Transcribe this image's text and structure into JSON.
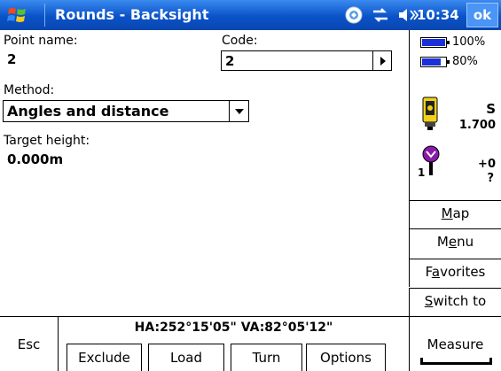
{
  "titlebar": {
    "title": "Rounds - Backsight",
    "time": "10:34",
    "ok_label": "ok"
  },
  "form": {
    "point_name_label": "Point name:",
    "point_name_value": "2",
    "code_label": "Code:",
    "code_value": "2",
    "method_label": "Method:",
    "method_value": "Angles and distance",
    "target_height_label": "Target height:",
    "target_height_value": "0.000m"
  },
  "status_panel": {
    "battery1": "100%",
    "battery1_level": 100,
    "battery2": "80%",
    "battery2_level": 80,
    "instrument_letter": "S",
    "instrument_value": "1.700",
    "target_offset": "+0",
    "target_number": "1",
    "target_unknown": "?"
  },
  "side_buttons": [
    {
      "pre": "",
      "key": "M",
      "post": "ap"
    },
    {
      "pre": "M",
      "key": "e",
      "post": "nu"
    },
    {
      "pre": "F",
      "key": "a",
      "post": "vorites"
    },
    {
      "pre": "",
      "key": "S",
      "post": "witch to"
    }
  ],
  "bottom": {
    "esc_label": "Esc",
    "angles": "HA:252°15'05\"  VA:82°05'12\"",
    "softkeys": [
      "Exclude",
      "Load",
      "Turn",
      "Options"
    ],
    "measure_label": "Measure"
  },
  "colors": {
    "titlebar": "#0a52c8",
    "battery": "#1a30d8",
    "target_purple": "#8a1aa8"
  },
  "icons": [
    "windows-logo",
    "gps-icon",
    "connectivity-icon",
    "speaker-icon",
    "dropdown-arrow-icon",
    "right-arrow-icon",
    "instrument-icon",
    "target-prism-icon"
  ]
}
